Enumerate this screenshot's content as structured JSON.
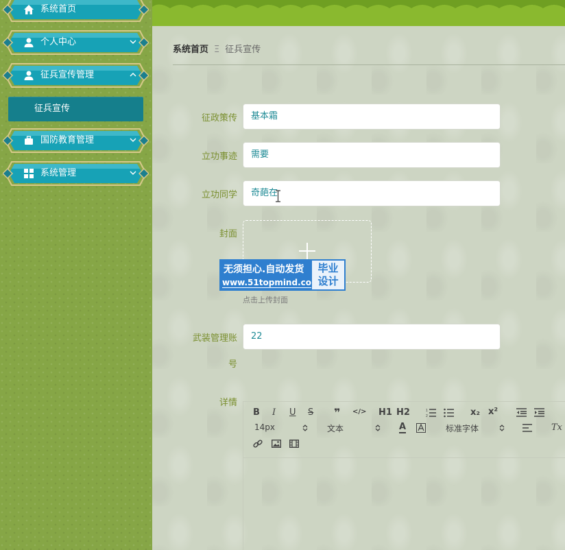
{
  "sidebar": {
    "items": [
      {
        "label": "系统首页",
        "icon": "home-icon"
      },
      {
        "label": "个人中心",
        "icon": "user-icon"
      },
      {
        "label": "征兵宣传管理",
        "icon": "user-icon"
      },
      {
        "label": "国防教育管理",
        "icon": "briefcase-icon"
      },
      {
        "label": "系统管理",
        "icon": "grid-icon"
      }
    ],
    "sub_item": "征兵宣传"
  },
  "breadcrumb": {
    "home": "系统首页",
    "separator": "Ξ",
    "current": "征兵宣传"
  },
  "form": {
    "policy": {
      "label": "征政策传",
      "value": "基本霜"
    },
    "deeds": {
      "label": "立功事迹",
      "value": "需要"
    },
    "classmate": {
      "label": "立功同学",
      "value": "奇葩在"
    },
    "cover": {
      "label": "封面",
      "hint": "点击上传封面"
    },
    "account": {
      "label_line1": "武装管理账",
      "label_line2": "号",
      "value": "22"
    },
    "details": {
      "label": "详情"
    }
  },
  "editor": {
    "font_size": "14px",
    "block_type": "文本",
    "font_family": "标准字体",
    "buttons": [
      "B",
      "I",
      "U",
      "S",
      "❞",
      "</>",
      "H1",
      "H2",
      "ordered-list",
      "bullet-list",
      "x₂",
      "x²",
      "outdent",
      "indent",
      "A",
      "highlight",
      "align",
      "Tx",
      "link",
      "image",
      "video"
    ]
  },
  "watermark": {
    "line1": "无须担心.自动发货",
    "line2": "www.51topmind.com",
    "box_line1": "毕业",
    "box_line2": "设计"
  },
  "colors": {
    "sidebar": "#86a646",
    "topbar": "#8ab92f",
    "nav_teal": "#17a2b6",
    "label_green": "#7a8f2f",
    "input_text": "#1e8a95"
  }
}
